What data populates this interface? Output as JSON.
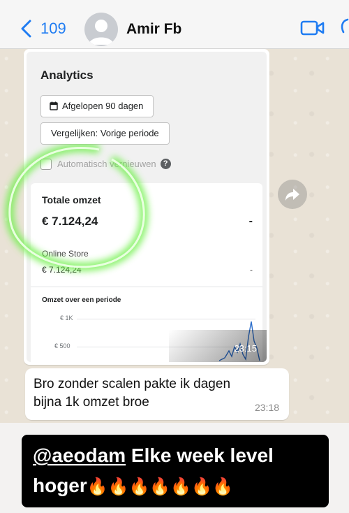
{
  "header": {
    "back_count": "109",
    "contact_name": "Amir Fb"
  },
  "screenshot": {
    "title": "Analytics",
    "date_range_button": "Afgelopen 90 dagen",
    "compare_button": "Vergelijken: Vorige periode",
    "auto_refresh_label": "Automatisch vernieuwen",
    "card": {
      "label": "Totale omzet",
      "total": "€ 7.124,24",
      "total_change": "-",
      "store_label": "Online Store",
      "store_value": "€ 7.124,24",
      "store_change": "-",
      "period_label": "Omzet over een periode",
      "axis_ticks": [
        "€ 1K",
        "€ 500"
      ]
    },
    "time": "23:15"
  },
  "message": {
    "text": "Bro zonder scalen pakte ik dagen bijna 1k omzet broe",
    "time": "23:18"
  },
  "caption": {
    "mention": "@aeodam",
    "text_after_mention": " Elke week level",
    "line2": "hoger",
    "emojis": "🔥🔥🔥🔥🔥🔥🔥"
  },
  "colors": {
    "accent_blue": "#1f7cf2",
    "glow_green": "#7cf25a"
  },
  "icons": [
    "back-chevron-icon",
    "avatar-icon",
    "video-call-icon",
    "calendar-icon",
    "help-icon",
    "forward-icon"
  ]
}
